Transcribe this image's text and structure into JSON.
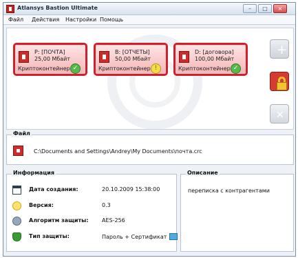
{
  "window": {
    "title": "Atlansys Bastion Ultimate"
  },
  "menu": [
    "Файл",
    "Действия",
    "Настройки",
    "Помощь"
  ],
  "containers": [
    {
      "name": "P: [ПОЧТА]",
      "size": "25,00 Мбайт",
      "type": "Криптоконтейнер",
      "status": "ok"
    },
    {
      "name": "B: [ОТЧЕТЫ]",
      "size": "50,00 Мбайт",
      "type": "Криптоконтейнер",
      "status": "warning"
    },
    {
      "name": "D: [договора]",
      "size": "100,00 Мбайт",
      "type": "Криптоконтейнер",
      "status": "ok"
    }
  ],
  "file": {
    "label": "Файл",
    "path": "C:\\Documents and Settings\\Andrey\\My Documents\\почта.crc"
  },
  "info": {
    "label": "Информация",
    "rows": [
      {
        "label": "Дата создания:",
        "value": "20.10.2009 15:38:00",
        "icon": "calendar-icon"
      },
      {
        "label": "Версия:",
        "value": "0.3",
        "icon": "bulb-icon"
      },
      {
        "label": "Алгоритм защиты:",
        "value": "AES-256",
        "icon": "gears-icon"
      },
      {
        "label": "Тип защиты:",
        "value": "Пароль + Сертификат",
        "icon": "shield-icon"
      }
    ]
  },
  "description": {
    "label": "Описание",
    "text": "переписка с контрагентами"
  },
  "colors": {
    "accent": "#d11f2c",
    "status_ok": "#58b84b",
    "status_warning": "#f3dc4a"
  }
}
